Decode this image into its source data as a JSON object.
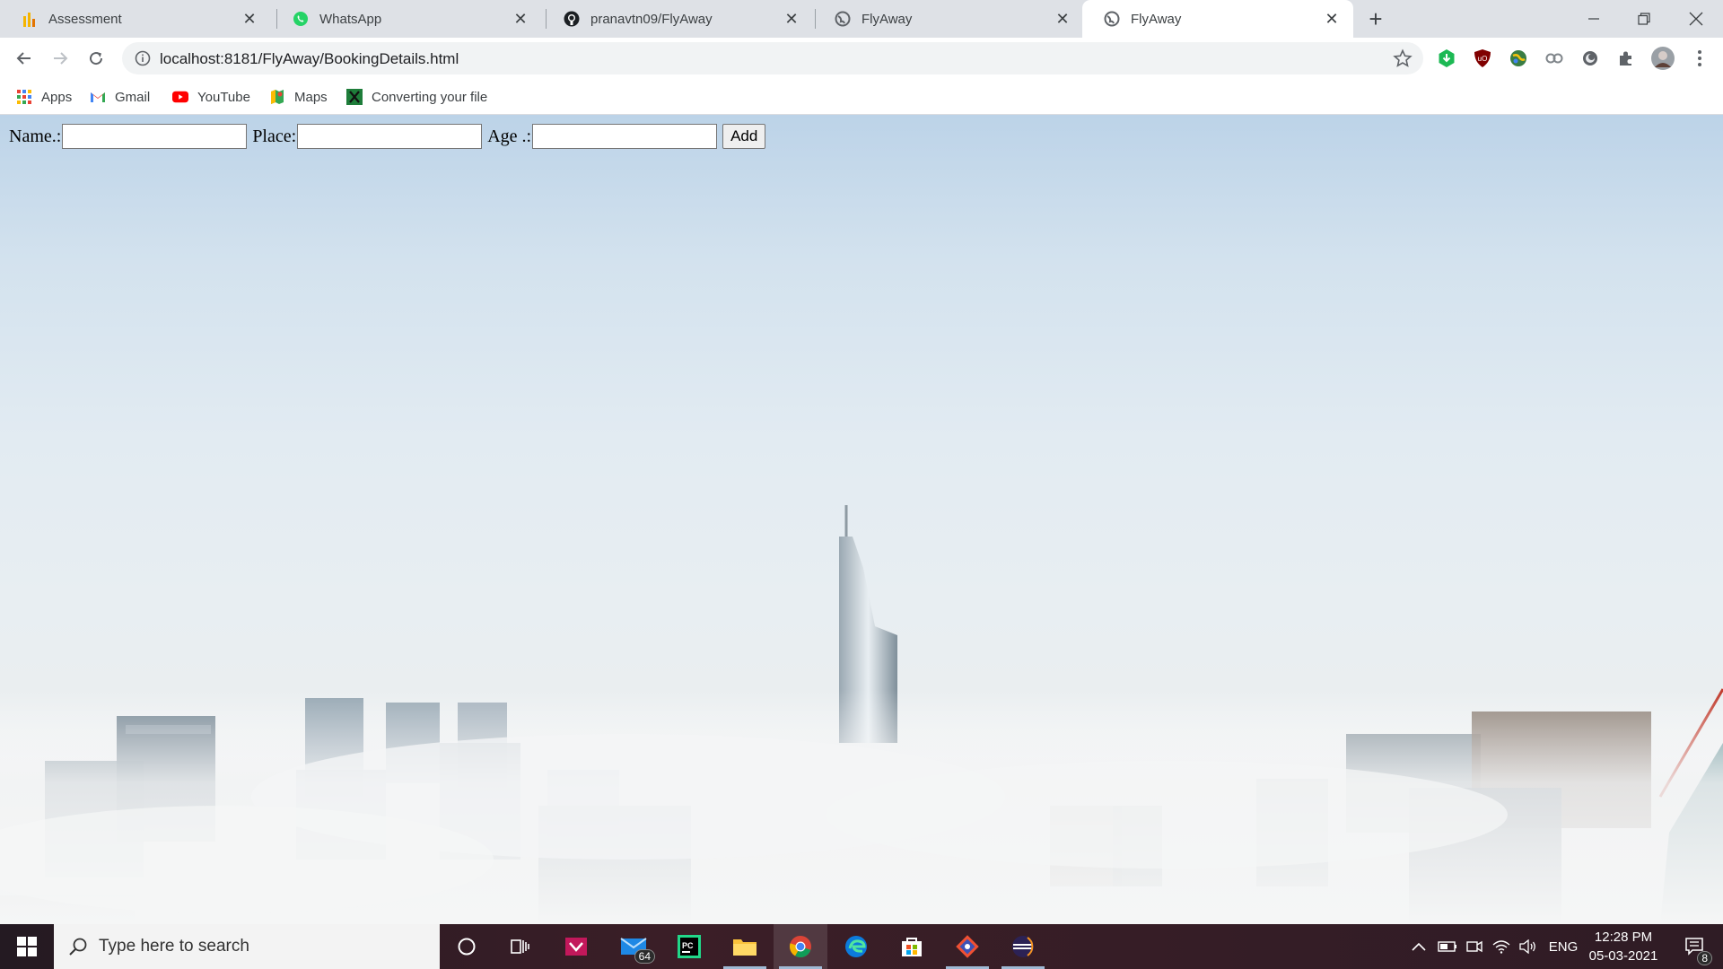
{
  "tabs": [
    {
      "title": "Assessment",
      "icon": "assessment-icon",
      "active": false
    },
    {
      "title": "WhatsApp",
      "icon": "whatsapp-icon",
      "active": false
    },
    {
      "title": "pranavtn09/FlyAway",
      "icon": "github-icon",
      "active": false
    },
    {
      "title": "FlyAway",
      "icon": "globe-icon",
      "active": false
    },
    {
      "title": "FlyAway",
      "icon": "globe-icon",
      "active": true
    }
  ],
  "toolbar": {
    "url": "localhost:8181/FlyAway/BookingDetails.html"
  },
  "bookmarks": [
    {
      "label": "Apps",
      "icon": "apps-grid-icon"
    },
    {
      "label": "Gmail",
      "icon": "gmail-icon"
    },
    {
      "label": "YouTube",
      "icon": "youtube-icon"
    },
    {
      "label": "Maps",
      "icon": "maps-icon"
    },
    {
      "label": "Converting your file",
      "icon": "converter-icon"
    }
  ],
  "form": {
    "name_label": "Name.:",
    "name_value": "",
    "place_label": "Place:",
    "place_value": "",
    "age_label": "Age .:",
    "age_value": "",
    "add_label": "Add"
  },
  "taskbar": {
    "search_placeholder": "Type here to search",
    "mail_badge": "64",
    "language": "ENG",
    "time": "12:28 PM",
    "date": "05-03-2021",
    "notification_count": "8"
  },
  "colors": {
    "tabstrip": "#dee1e6",
    "omnibox": "#f1f3f4",
    "taskbar": "#3a1f2a"
  }
}
